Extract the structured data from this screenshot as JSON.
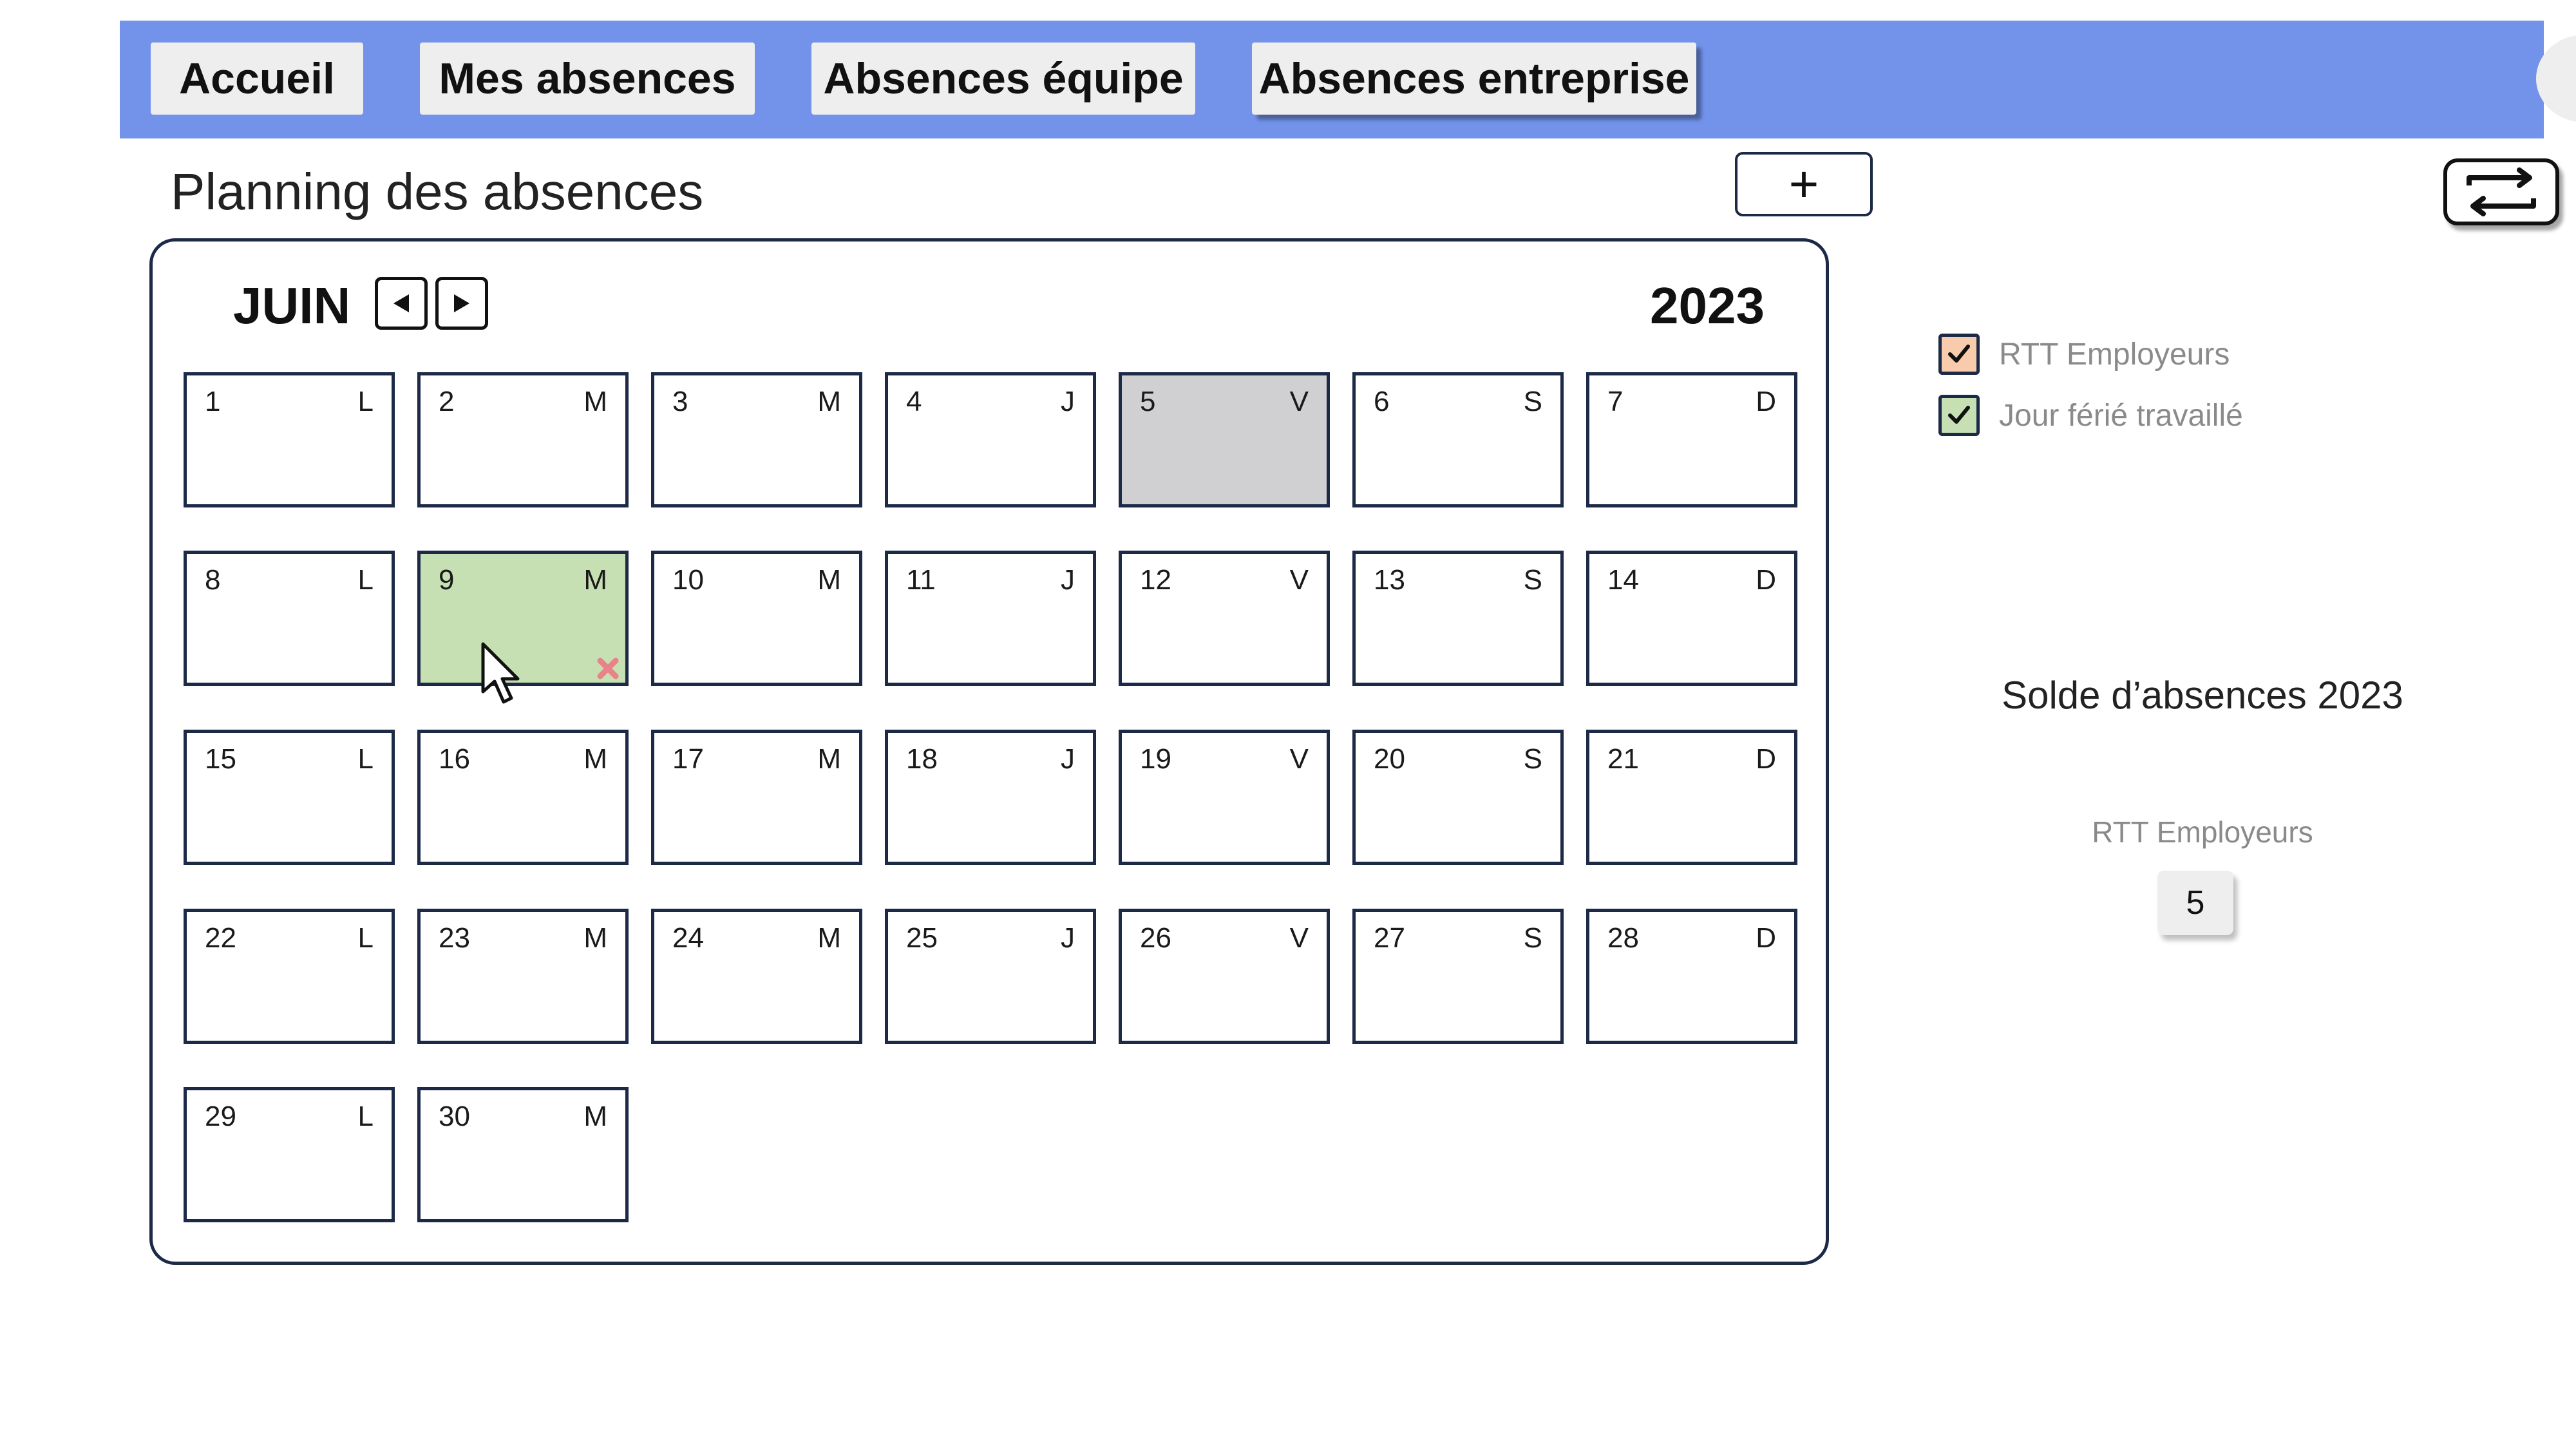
{
  "nav": {
    "tabs": [
      {
        "label": "Accueil"
      },
      {
        "label": "Mes absences"
      },
      {
        "label": "Absences équipe"
      },
      {
        "label": "Absences entreprise",
        "active": true
      }
    ]
  },
  "page": {
    "title": "Planning des absences",
    "add_label": "+"
  },
  "calendar": {
    "month": "JUIN",
    "year": "2023",
    "days": [
      {
        "num": "1",
        "letter": "L"
      },
      {
        "num": "2",
        "letter": "M"
      },
      {
        "num": "3",
        "letter": "M"
      },
      {
        "num": "4",
        "letter": "J"
      },
      {
        "num": "5",
        "letter": "V",
        "status": "holiday"
      },
      {
        "num": "6",
        "letter": "S"
      },
      {
        "num": "7",
        "letter": "D"
      },
      {
        "num": "8",
        "letter": "L"
      },
      {
        "num": "9",
        "letter": "M",
        "status": "Jour férié travaillé"
      },
      {
        "num": "10",
        "letter": "M"
      },
      {
        "num": "11",
        "letter": "J"
      },
      {
        "num": "12",
        "letter": "V"
      },
      {
        "num": "13",
        "letter": "S"
      },
      {
        "num": "14",
        "letter": "D"
      },
      {
        "num": "15",
        "letter": "L"
      },
      {
        "num": "16",
        "letter": "M"
      },
      {
        "num": "17",
        "letter": "M"
      },
      {
        "num": "18",
        "letter": "J"
      },
      {
        "num": "19",
        "letter": "V"
      },
      {
        "num": "20",
        "letter": "S"
      },
      {
        "num": "21",
        "letter": "D"
      },
      {
        "num": "22",
        "letter": "L"
      },
      {
        "num": "23",
        "letter": "M"
      },
      {
        "num": "24",
        "letter": "M"
      },
      {
        "num": "25",
        "letter": "J"
      },
      {
        "num": "26",
        "letter": "V"
      },
      {
        "num": "27",
        "letter": "S"
      },
      {
        "num": "28",
        "letter": "D"
      },
      {
        "num": "29",
        "letter": "L"
      },
      {
        "num": "30",
        "letter": "M"
      }
    ]
  },
  "legend": {
    "items": [
      {
        "label": "RTT Employeurs",
        "color": "#f8cbad",
        "checked": true
      },
      {
        "label": "Jour férié travaillé",
        "color": "#c6e0b4",
        "checked": true
      }
    ]
  },
  "solde": {
    "title": "Solde d’absences 2023",
    "type": "RTT Employeurs",
    "value": "5"
  },
  "colors": {
    "topbar": "#7393eb",
    "holiday_cell": "#d0cfd1",
    "worked_holiday_cell": "#c6e0b4",
    "delete_mark": "#e8838a",
    "border": "#1c2a48"
  },
  "icons": {
    "prev": "triangle-left-icon",
    "next": "triangle-right-icon",
    "swap": "swap-arrows-icon",
    "delete": "close-icon",
    "cursor": "mouse-pointer-icon"
  }
}
